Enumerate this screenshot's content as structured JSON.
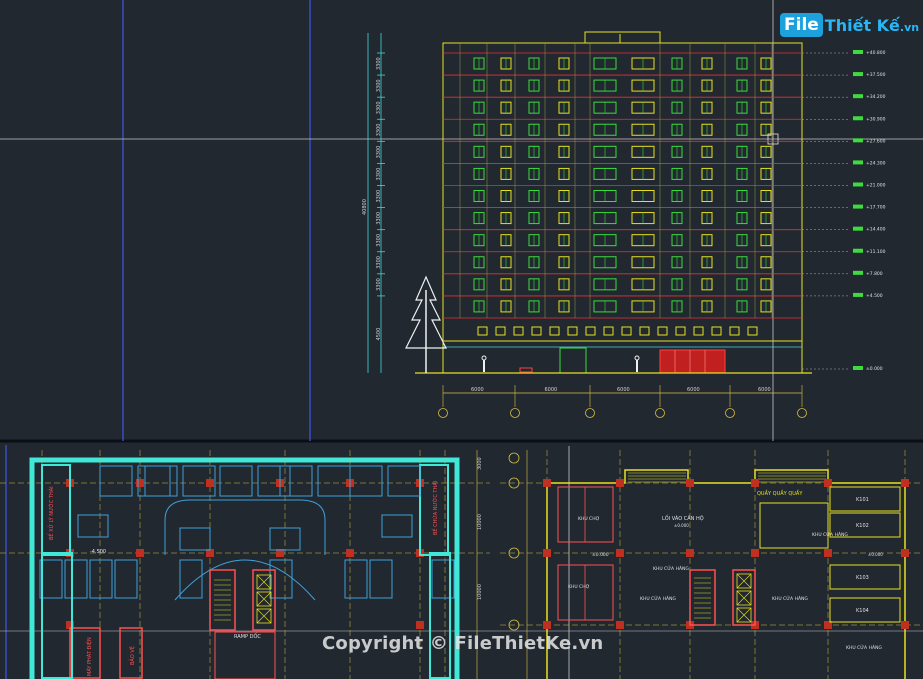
{
  "logo": {
    "file": "File",
    "rest": "Thiết Kế",
    "tld": ".vn"
  },
  "watermark": "Copyright © FileThietKe.vn",
  "elevation": {
    "floor_levels": [
      "+40.800",
      "+37.500",
      "+34.200",
      "+30.900",
      "+27.600",
      "+24.300",
      "+21.000",
      "+17.700",
      "+14.400",
      "+11.100",
      "+7.800",
      "+4.500",
      "±0.000"
    ],
    "floor_dims": [
      "3300",
      "3300",
      "3300",
      "3300",
      "3300",
      "3300",
      "3300",
      "3300",
      "3300",
      "3300",
      "3300",
      "4500"
    ],
    "bay_dims": [
      "6000",
      "6000",
      "6000",
      "6000",
      "6000"
    ],
    "total_height": "40800"
  },
  "plan_left": {
    "labels": {
      "tank_left": "BỂ XỬ LÝ NƯỚC THẢI",
      "tank_right": "BỂ CHỨA NƯỚC THẢI",
      "generator": "MÁY PHÁT ĐIỆN",
      "guard": "BẢO VỆ",
      "ramp": "RAMP DỐC",
      "level": "-4.500"
    }
  },
  "plan_right": {
    "labels": {
      "entrance": "LỐI VÀO CĂN HỘ",
      "entrance_level": "±0.000",
      "market": "KHU CHỢ",
      "market2": "KHU CHỢ",
      "shop1": "KHU CỬA HÀNG",
      "shop2": "KHU CỬA HÀNG",
      "shop3": "KHU CỬA HÀNG",
      "shop4": "KHU CỬA HÀNG",
      "counter": "QUẦY QUẦY QUẦY",
      "kiosk1": "K101",
      "kiosk2": "K102",
      "kiosk3": "K103",
      "kiosk4": "K104",
      "level": "±0.000"
    }
  },
  "colors": {
    "background": "#212830",
    "facade": "#e8e020",
    "window": "#3cdc3c",
    "floor_line": "#e83030",
    "grid": "#d8c040",
    "plan_wall": "#40e8d8",
    "axis": "#3050d0"
  }
}
